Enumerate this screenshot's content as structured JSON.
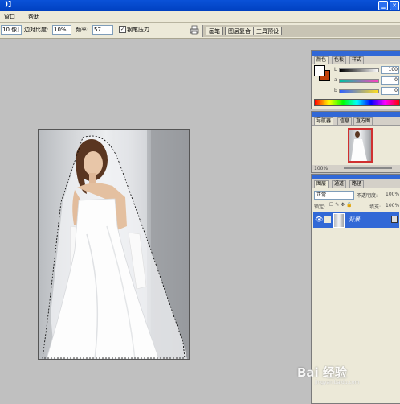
{
  "titlebar": {
    "title": ")]"
  },
  "menu": {
    "window": "窗口",
    "help": "帮助"
  },
  "options": {
    "width_value": "10 像]",
    "contrast_label": "边对比度:",
    "contrast_value": "10%",
    "frequency_label": "频率:",
    "frequency_value": "57",
    "pen_pressure_label": "钢笔压力",
    "pen_pressure_checked": "✓"
  },
  "palette_well": {
    "tabs": [
      "画笔",
      "图层复合",
      "工具预设"
    ]
  },
  "color_panel": {
    "tabs": [
      "颜色",
      "色板",
      "样式"
    ],
    "l_label": "L",
    "l_value": "100",
    "a_label": "a",
    "a_value": "0",
    "b_label": "b",
    "b_value": "0",
    "foreground_color": "#ffffff",
    "background_color": "#c0400a"
  },
  "navigator_panel": {
    "tabs": [
      "导航器",
      "信息",
      "直方图"
    ],
    "zoom": "100%"
  },
  "layers_panel": {
    "tabs": [
      "图层",
      "通道",
      "路径"
    ],
    "blend_mode": "正常",
    "opacity_label": "不透明度:",
    "opacity_value": "100%",
    "lock_label": "锁定:",
    "fill_label": "填充:",
    "fill_value": "100%",
    "layer_name": "背景"
  },
  "watermark": {
    "text": "Bai 经验",
    "sub": "jingyan.baidu.com"
  }
}
